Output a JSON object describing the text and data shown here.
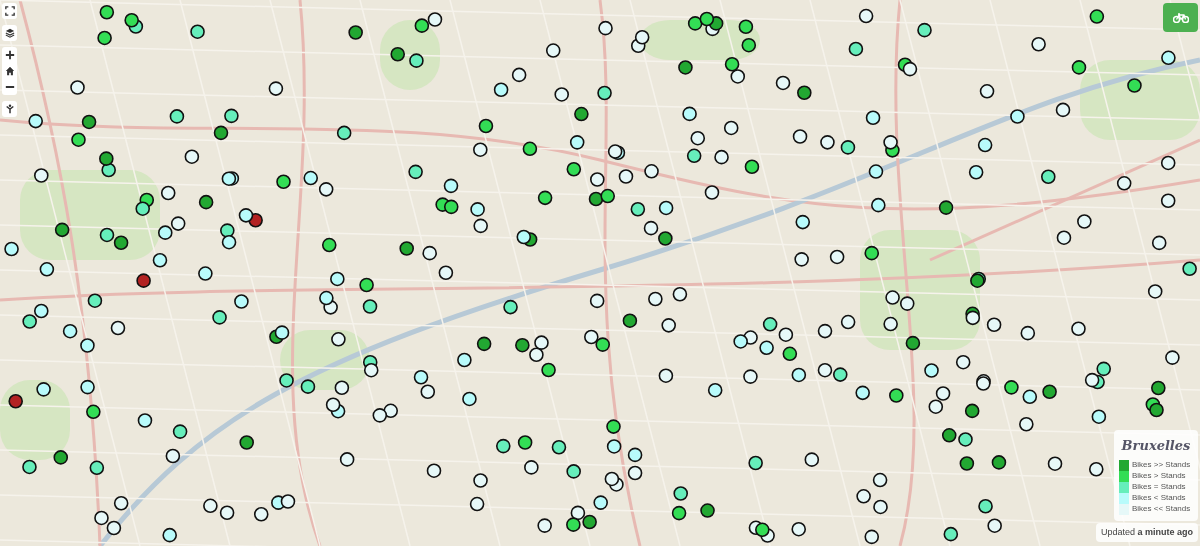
{
  "map": {
    "controls": [
      {
        "kind": "fullscreen"
      },
      {
        "kind": "layers"
      },
      {
        "kind": "zoom_in"
      },
      {
        "kind": "home"
      },
      {
        "kind": "zoom_out"
      },
      {
        "kind": "locate"
      }
    ]
  },
  "legend": {
    "title": "Bruxelles",
    "items": [
      {
        "label": "Bikes >> Stands",
        "color": "#22a832"
      },
      {
        "label": "Bikes > Stands",
        "color": "#33dd55"
      },
      {
        "label": "Bikes = Stands",
        "color": "#66eebb"
      },
      {
        "label": "Bikes < Stands",
        "color": "#b8fbfb"
      },
      {
        "label": "Bikes << Stands",
        "color": "#e6f8f8"
      }
    ]
  },
  "status": {
    "text": "Updated **a minute ago**"
  }
}
